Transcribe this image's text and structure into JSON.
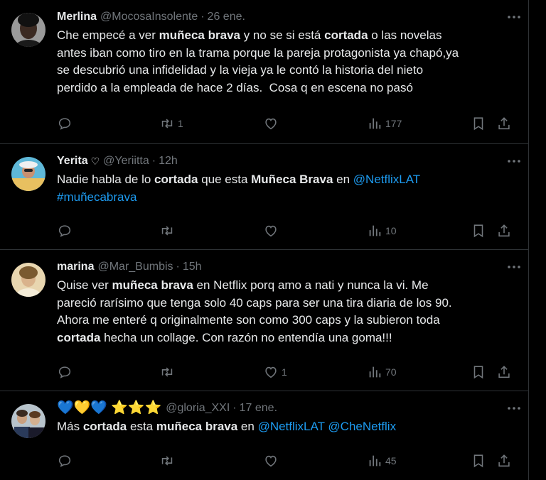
{
  "tweets": [
    {
      "name": "Merlina",
      "handle": "@MocosaInsolente",
      "time": "26 ene.",
      "segments": [
        {
          "t": "Che empecé a ver "
        },
        {
          "t": "muñeca brava",
          "b": true
        },
        {
          "t": " y no se si está "
        },
        {
          "t": "cortada",
          "b": true
        },
        {
          "t": " o las novelas\nantes iban como tiro en la trama porque la pareja protagonista ya chapó,ya\nse descubrió una infidelidad y la vieja ya le contó la historia del nieto\nperdido a la empleada de hace 2 días.  Cosa q en escena no pasó"
        }
      ],
      "replies": "",
      "retweets": "1",
      "likes": "",
      "views": "177"
    },
    {
      "name": "Yerita",
      "name_suffix": "♡",
      "handle": "@Yeriitta",
      "time": "12h",
      "segments": [
        {
          "t": "Nadie habla de lo "
        },
        {
          "t": "cortada",
          "b": true
        },
        {
          "t": " que esta "
        },
        {
          "t": "Muñeca Brava",
          "b": true
        },
        {
          "t": " en "
        },
        {
          "t": "@NetflixLAT",
          "l": true
        },
        {
          "t": "\n"
        },
        {
          "t": "#muñecabrava",
          "l": true
        }
      ],
      "replies": "",
      "retweets": "",
      "likes": "",
      "views": "10"
    },
    {
      "name": "marina",
      "handle": "@Mar_Bumbis",
      "time": "15h",
      "segments": [
        {
          "t": "Quise ver "
        },
        {
          "t": "muñeca brava",
          "b": true
        },
        {
          "t": " en Netflix porq amo a nati y nunca la vi. Me\npareció rarísimo que tenga solo 40 caps para ser una tira diaria de los 90.\nAhora me enteré q originalmente son como 300 caps y la subieron toda\n"
        },
        {
          "t": "cortada",
          "b": true
        },
        {
          "t": " hecha un collage. Con razón no entendía una goma!!!"
        }
      ],
      "replies": "",
      "retweets": "",
      "likes": "1",
      "views": "70"
    },
    {
      "name": "💙💛💙 ⭐⭐⭐",
      "handle": "@gloria_XXI",
      "time": "17 ene.",
      "segments": [
        {
          "t": "Más "
        },
        {
          "t": "cortada",
          "b": true
        },
        {
          "t": " esta "
        },
        {
          "t": "muñeca brava",
          "b": true
        },
        {
          "t": " en "
        },
        {
          "t": "@NetflixLAT",
          "l": true
        },
        {
          "t": " "
        },
        {
          "t": "@CheNetflix",
          "l": true
        }
      ],
      "replies": "",
      "retweets": "",
      "likes": "",
      "views": "45"
    }
  ],
  "colors": {
    "background": "#000000",
    "text": "#e7e9ea",
    "muted": "#71767b",
    "link": "#1d9bf0",
    "divider": "#2f3336"
  },
  "icons": [
    "reply-icon",
    "retweet-icon",
    "like-icon",
    "views-icon",
    "bookmark-icon",
    "share-icon",
    "more-icon"
  ]
}
